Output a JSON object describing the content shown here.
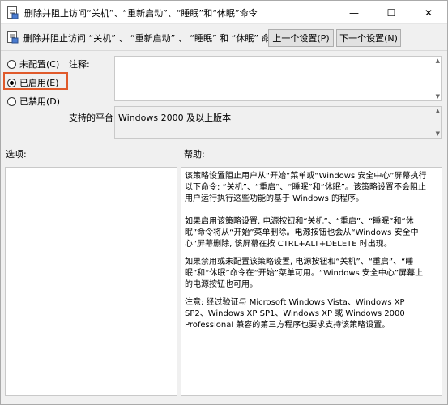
{
  "window": {
    "title": "删除并阻止访问“关机”、“重新启动”、“睡眠”和“休眠”命令",
    "minimize_glyph": "—",
    "maximize_glyph": "☐",
    "close_glyph": "✕"
  },
  "header": {
    "policy_name": "删除并阻止访问 “关机” 、 “重新启动” 、 “睡眠” 和 “休眠” 命令",
    "prev_button": "上一个设置(P)",
    "next_button": "下一个设置(N)"
  },
  "state": {
    "not_configured": "未配置(C)",
    "enabled": "已启用(E)",
    "disabled": "已禁用(D)",
    "selected": "enabled"
  },
  "comment": {
    "label": "注释:",
    "value": ""
  },
  "platform": {
    "label": "支持的平台:",
    "value": "Windows 2000 及以上版本"
  },
  "options": {
    "label": "选项:"
  },
  "help": {
    "label": "帮助:",
    "paragraphs": [
      "该策略设置阻止用户从“开始”菜单或“Windows 安全中心”屏幕执行以下命令: “关机”、“重启”、“睡眠”和“休眠”。该策略设置不会阻止用户运行执行这些功能的基于 Windows 的程序。",
      "如果启用该策略设置, 电源按钮和“关机”、“重启”、“睡眠”和“休眠”命令将从“开始”菜单删除。电源按钮也会从“Windows 安全中心”屏幕删除, 该屏幕在按 CTRL+ALT+DELETE 时出现。",
      "如果禁用或未配置该策略设置, 电源按钮和“关机”、“重启”、“睡眠”和“休眠”命令在“开始”菜单可用。“Windows 安全中心”屏幕上的电源按钮也可用。",
      "注意: 经过验证与 Microsoft Windows Vista、Windows XP SP2、Windows XP SP1、Windows XP 或 Windows 2000 Professional 兼容的第三方程序也要求支持该策略设置。"
    ]
  },
  "colors": {
    "highlight_box": "#e05a2b",
    "window_bg": "#f0f0f0"
  },
  "icons": [
    "policy-setting-icon",
    "minimize-icon",
    "maximize-icon",
    "close-icon"
  ]
}
